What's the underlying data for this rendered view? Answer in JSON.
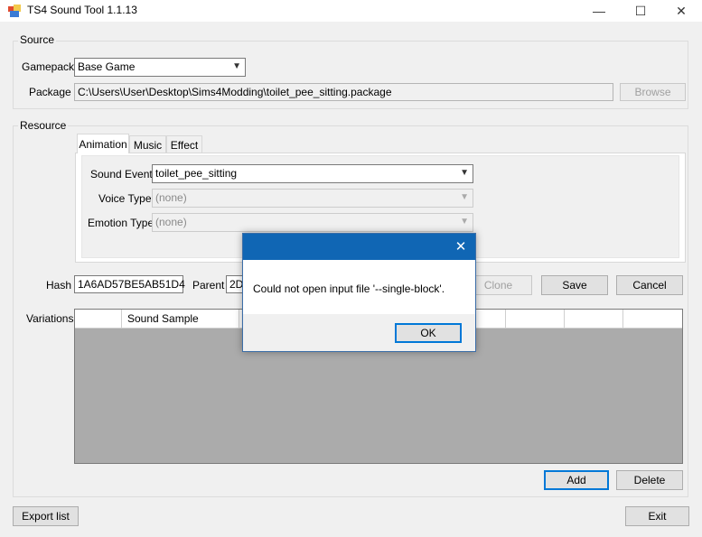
{
  "window": {
    "title": "TS4 Sound Tool 1.1.13",
    "minimize": "—",
    "maximize": "☐",
    "close": "✕"
  },
  "source": {
    "group_label": "Source",
    "gamepack_label": "Gamepack",
    "gamepack_value": "Base Game",
    "package_label": "Package",
    "package_value": "C:\\Users\\User\\Desktop\\Sims4Modding\\toilet_pee_sitting.package",
    "browse_label": "Browse"
  },
  "resource": {
    "group_label": "Resource",
    "tabs": [
      {
        "label": "Animation",
        "active": true
      },
      {
        "label": "Music",
        "active": false
      },
      {
        "label": "Effect",
        "active": false
      }
    ],
    "sound_event_label": "Sound Event",
    "sound_event_value": "toilet_pee_sitting",
    "voice_type_label": "Voice Type",
    "voice_type_value": "(none)",
    "emotion_type_label": "Emotion Type",
    "emotion_type_value": "(none)",
    "hash_label": "Hash",
    "hash_value": "1A6AD57BE5AB51D4",
    "parent_label": "Parent",
    "parent_value": "2D",
    "clone_label": "Clone",
    "save_label": "Save",
    "cancel_label": "Cancel"
  },
  "variations": {
    "label": "Variations",
    "columns": [
      "",
      "Sound Sample"
    ],
    "add_label": "Add",
    "delete_label": "Delete"
  },
  "footer": {
    "export_label": "Export list",
    "exit_label": "Exit"
  },
  "dialog": {
    "close": "✕",
    "message": "Could not open input file '--single-block'.",
    "ok_label": "OK"
  },
  "colors": {
    "dialog_title": "#1066b4",
    "accent": "#0078d7"
  }
}
